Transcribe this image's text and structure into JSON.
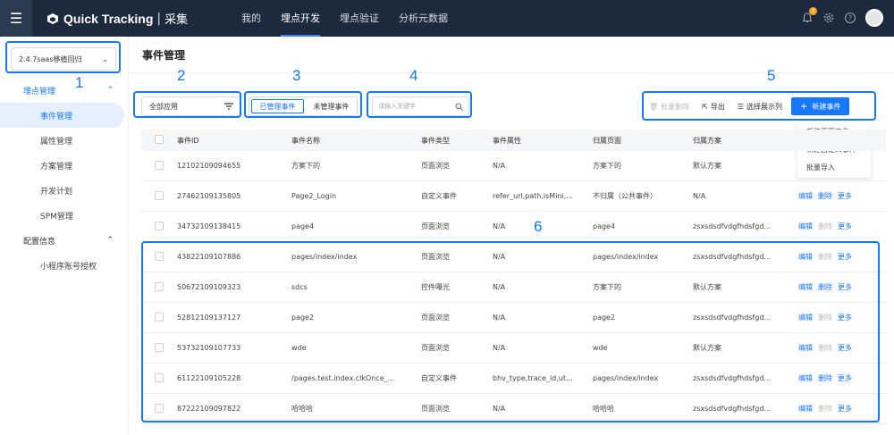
{
  "topbar": {
    "logo_text": "Quick Tracking",
    "logo_sep": "|",
    "logo_sub": "采集",
    "nav": [
      {
        "label": "我的"
      },
      {
        "label": "埋点开发"
      },
      {
        "label": "埋点验证"
      },
      {
        "label": "分析元数据"
      }
    ],
    "notification_count": "7"
  },
  "sidebar": {
    "version": "2.4.7saas移植回归",
    "groups": [
      {
        "label": "埋点管理",
        "items": [
          {
            "label": "事件管理"
          },
          {
            "label": "属性管理"
          },
          {
            "label": "方案管理"
          },
          {
            "label": "开发计划"
          },
          {
            "label": "SPM管理"
          }
        ]
      },
      {
        "label": "配置信息",
        "items": [
          {
            "label": "小程序账号授权"
          }
        ]
      }
    ]
  },
  "main": {
    "title": "事件管理",
    "filters": {
      "app_select": "全部应用",
      "tabs": [
        {
          "label": "已管理事件"
        },
        {
          "label": "未管理事件"
        }
      ],
      "search_placeholder": "请输入关键字"
    },
    "toolbar": {
      "batch_delete": "批量删除",
      "export": "导出",
      "choose_columns": "选择展示列",
      "new_event": "新建事件"
    },
    "new_dropdown": [
      {
        "label": "新建页面事件"
      },
      {
        "label": "新建自定义事件"
      },
      {
        "label": "批量导入"
      }
    ],
    "table": {
      "columns": [
        "事件ID",
        "事件名称",
        "事件类型",
        "事件属性",
        "归属页面",
        "归属方案"
      ],
      "op_labels": {
        "edit": "编辑",
        "delete": "删除",
        "more": "更多"
      },
      "rows": [
        {
          "id": "12102109094655",
          "name": "方案下的",
          "type": "页面浏览",
          "attr": "N/A",
          "page": "方案下的",
          "plan": "默认方案"
        },
        {
          "id": "27462109135805",
          "name": "Page2_Login",
          "type": "自定义事件",
          "attr": "refer_url,path,isMini,...",
          "page": "不归属（公共事件）",
          "plan": "N/A"
        },
        {
          "id": "34732109138415",
          "name": "page4",
          "type": "页面浏览",
          "attr": "N/A",
          "page": "page4",
          "plan": "zsxsdsdfvdgfhdsfgd..."
        },
        {
          "id": "43822109107886",
          "name": "pages/index/index",
          "type": "页面浏览",
          "attr": "N/A",
          "page": "pages/index/index",
          "plan": "zsxsdsdfvdgfhdsfgd..."
        },
        {
          "id": "50672109109323",
          "name": "sdcs",
          "type": "控件曝光",
          "attr": "N/A",
          "page": "方案下的",
          "plan": "默认方案"
        },
        {
          "id": "52812109137127",
          "name": "page2",
          "type": "页面浏览",
          "attr": "N/A",
          "page": "page2",
          "plan": "zsxsdsdfvdgfhdsfgd..."
        },
        {
          "id": "53732109107733",
          "name": "wde",
          "type": "页面浏览",
          "attr": "N/A",
          "page": "wde",
          "plan": "默认方案"
        },
        {
          "id": "61122109105228",
          "name": "/pages.test.index.clkOnce_...",
          "type": "自定义事件",
          "attr": "bhv_type,trace_id,ut...",
          "page": "pages/index/index",
          "plan": "zsxsdsdfvdgfhdsfgd..."
        },
        {
          "id": "87222109097822",
          "name": "哈哈哈",
          "type": "页面浏览",
          "attr": "N/A",
          "page": "哈哈哈",
          "plan": "zsxsdsdfvdgfhdsfgd..."
        }
      ]
    }
  },
  "annotations": [
    "1",
    "2",
    "3",
    "4",
    "5",
    "6"
  ],
  "colors": {
    "topbar": "#1d2a3d",
    "accent": "#1677ff",
    "badge": "#f5a623"
  }
}
